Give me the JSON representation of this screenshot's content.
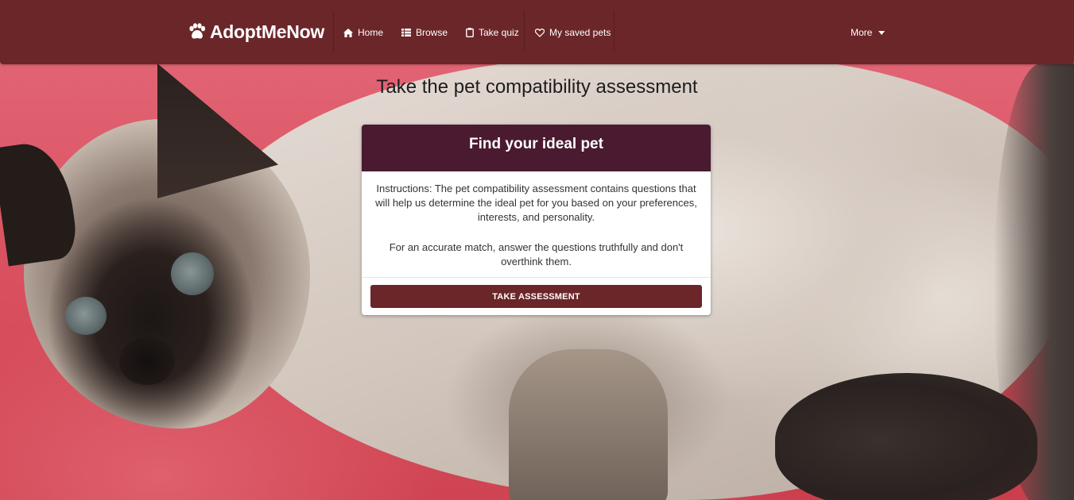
{
  "nav": {
    "brand": "AdoptMeNow",
    "items": [
      {
        "label": "Home",
        "icon": "home-icon"
      },
      {
        "label": "Browse",
        "icon": "grid-icon"
      },
      {
        "label": "Take quiz",
        "icon": "clipboard-icon"
      },
      {
        "label": "My saved pets",
        "icon": "heart-icon"
      }
    ],
    "more_label": "More"
  },
  "page": {
    "title": "Take the pet compatibility assessment"
  },
  "card": {
    "title": "Find your ideal pet",
    "instructions": "Instructions: The pet compatibility assessment contains questions that will help us determine the ideal pet for you based on your preferences, interests, and personality.",
    "note": "For an accurate match, answer the questions truthfully and don't overthink them.",
    "button_label": "TAKE ASSESSMENT"
  },
  "colors": {
    "navbar": "#6b2629",
    "card_header": "#4a1a30",
    "button": "#6b2629"
  }
}
